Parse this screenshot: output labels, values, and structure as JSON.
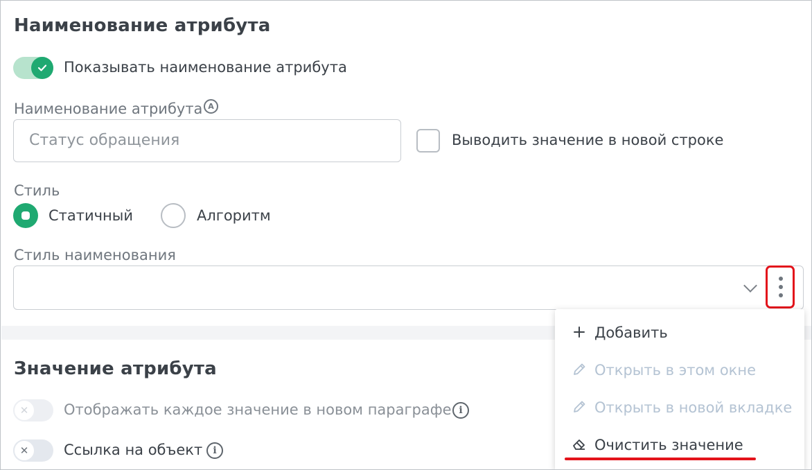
{
  "name_section": {
    "title": "Наименование атрибута",
    "show_name_toggle": {
      "label": "Показывать наименование атрибута",
      "checked": true
    },
    "name_field": {
      "label": "Наименование атрибута",
      "badge": "A",
      "placeholder": "Статус обращения"
    },
    "new_line_checkbox": {
      "label": "Выводить значение в новой строке",
      "checked": false
    },
    "style": {
      "label": "Стиль",
      "options": [
        {
          "label": "Статичный",
          "selected": true
        },
        {
          "label": "Алгоритм",
          "selected": false
        }
      ]
    },
    "name_style": {
      "label": "Стиль наименования",
      "value": ""
    }
  },
  "value_section": {
    "title": "Значение атрибута",
    "paragraph_toggle": {
      "label": "Отображать каждое значение в новом параграфе",
      "checked": false,
      "disabled": true
    },
    "object_link_toggle": {
      "label": "Ссылка на объект",
      "checked": false,
      "disabled": false
    }
  },
  "context_menu": {
    "items": [
      {
        "label": "Добавить",
        "icon": "plus-icon",
        "enabled": true
      },
      {
        "label": "Открыть в этом окне",
        "icon": "pencil-icon",
        "enabled": false
      },
      {
        "label": "Открыть в новой вкладке",
        "icon": "pencil-icon",
        "enabled": false
      },
      {
        "label": "Очистить значение",
        "icon": "eraser-icon",
        "enabled": true
      }
    ]
  },
  "colors": {
    "accent": "#1fa971",
    "highlight": "#e3131b",
    "disabled_text": "#b4c3d3"
  }
}
